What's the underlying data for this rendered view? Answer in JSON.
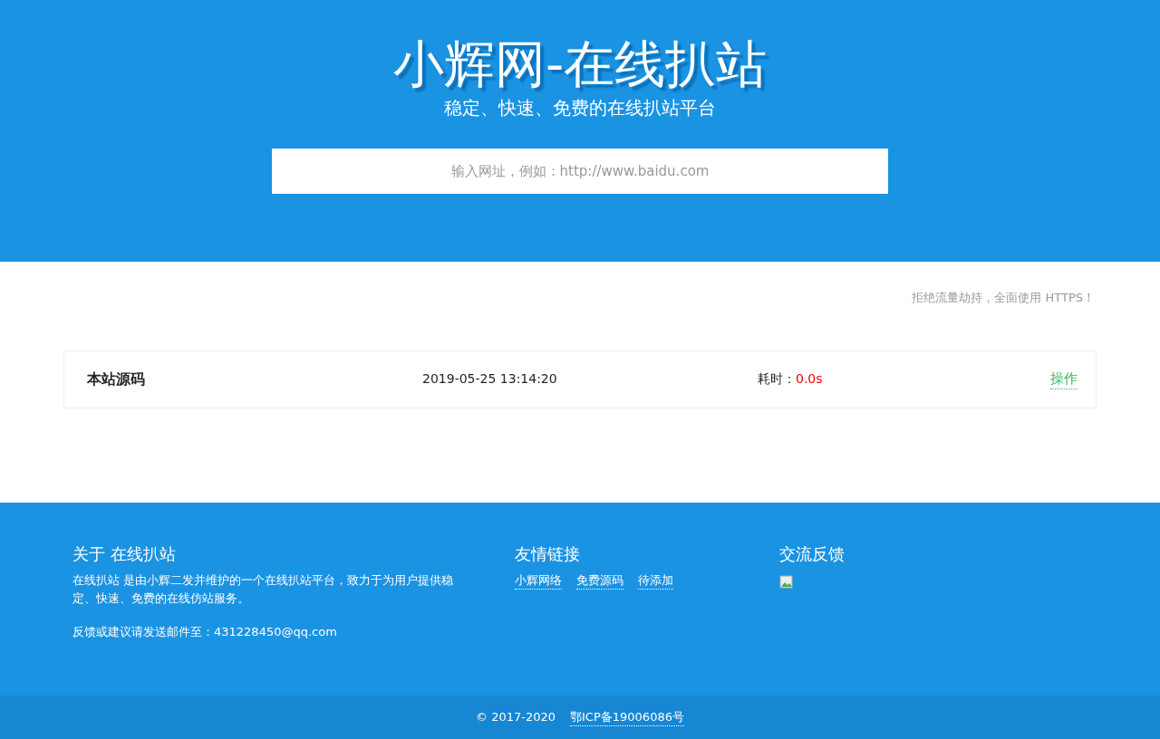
{
  "header": {
    "title": "小辉网-在线扒站",
    "subtitle": "稳定、快速、免费的在线扒站平台",
    "search": {
      "placeholder": "输入网址，例如：http://www.baidu.com"
    }
  },
  "notice": "拒绝流量劫持，全面使用 HTTPS！",
  "records": [
    {
      "name": "本站源码",
      "time": "2019-05-25 13:14:20",
      "duration_label": "耗时：",
      "duration": "0.0s",
      "action": "操作"
    }
  ],
  "footer": {
    "about": {
      "heading": "关于 在线扒站",
      "text": "在线扒站 是由小辉二发并维护的一个在线扒站平台，致力于为用户提供稳定、快速、免费的在线仿站服务。",
      "contact": "反馈或建议请发送邮件至：431228450@qq.com"
    },
    "links": {
      "heading": "友情链接",
      "items": [
        "小辉网络",
        "免费源码",
        "待添加"
      ]
    },
    "feedback": {
      "heading": "交流反馈"
    }
  },
  "bottom": {
    "copyright": "© 2017-2020",
    "icp": "鄂ICP备19006086号"
  }
}
